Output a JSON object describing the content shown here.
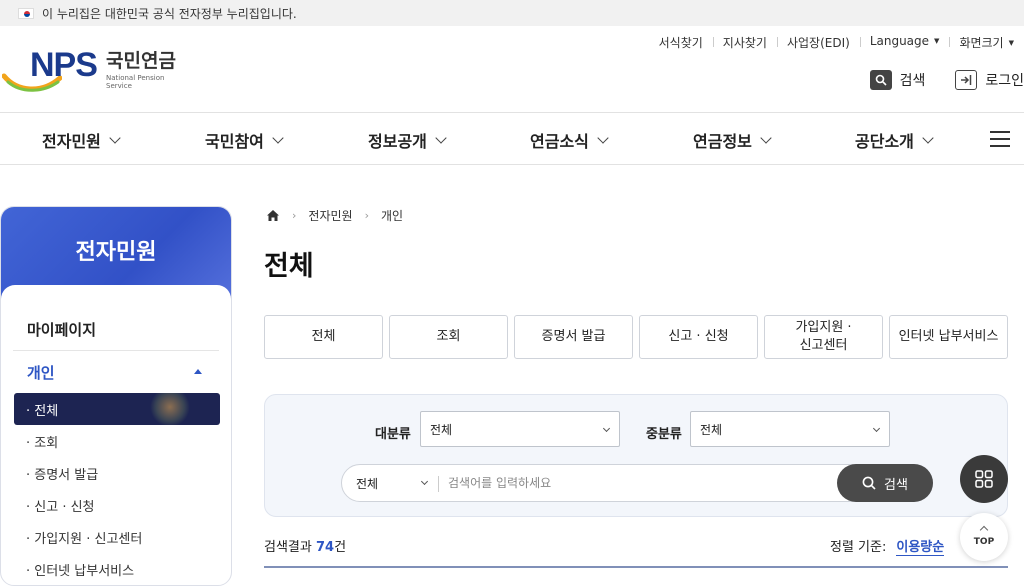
{
  "gov_banner": {
    "text": "이 누리집은 대한민국 공식 전자정부 누리집입니다."
  },
  "logo": {
    "brand": "NPS",
    "name_ko": "국민연금",
    "name_en": "National Pension Service"
  },
  "utility_links": [
    {
      "label": "서식찾기"
    },
    {
      "label": "지사찾기"
    },
    {
      "label": "사업장(EDI)"
    },
    {
      "label": "Language",
      "dropdown": true
    },
    {
      "label": "화면크기",
      "dropdown": true
    }
  ],
  "header_buttons": {
    "search": "검색",
    "login": "로그인"
  },
  "gnb": [
    "전자민원",
    "국민참여",
    "정보공개",
    "연금소식",
    "연금정보",
    "공단소개"
  ],
  "sidebar": {
    "title": "전자민원",
    "mypage": "마이페이지",
    "section": "개인",
    "items": [
      "· 전체",
      "· 조회",
      "· 증명서 발급",
      "· 신고 · 신청",
      "· 가입지원 · 신고센터",
      "· 인터넷 납부서비스"
    ],
    "active_index": 0
  },
  "breadcrumb": {
    "level1": "전자민원",
    "level2": "개인"
  },
  "page_title": "전체",
  "tabs": [
    "전체",
    "조회",
    "증명서 발급",
    "신고 · 신청",
    "가입지원 ·\n신고센터",
    "인터넷 납부서비스"
  ],
  "search": {
    "major_label": "대분류",
    "major_value": "전체",
    "minor_label": "중분류",
    "minor_value": "전체",
    "scope_value": "전체",
    "placeholder": "검색어를 입력하세요",
    "button": "검색"
  },
  "results": {
    "prefix": "검색결과 ",
    "count": "74",
    "suffix": "건"
  },
  "sort": {
    "label": "정렬 기준:",
    "current": "이용량순"
  },
  "fab": {
    "top_label": "TOP"
  },
  "colors": {
    "brand_blue": "#2e56c4",
    "sidebar_header": "#3b5bd0",
    "active_item": "#1d2452",
    "search_button": "#4a4a4a"
  }
}
